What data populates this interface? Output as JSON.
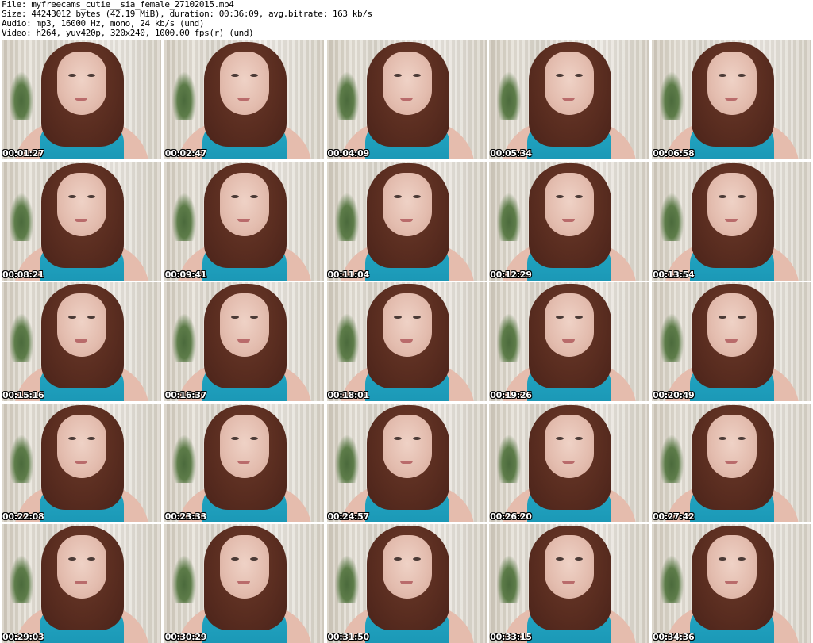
{
  "header": {
    "file": "File: myfreecams_cutie__sia_female_27102015.mp4",
    "size": "Size: 44243012 bytes (42.19 MiB), duration: 00:36:09, avg.bitrate: 163 kb/s",
    "audio": "Audio: mp3, 16000 Hz, mono, 24 kb/s (und)",
    "video": "Video: h264, yuv420p, 320x240, 1000.00 fps(r) (und)"
  },
  "thumbnails": [
    {
      "time": "00:01:27"
    },
    {
      "time": "00:02:47"
    },
    {
      "time": "00:04:09"
    },
    {
      "time": "00:05:34"
    },
    {
      "time": "00:06:58"
    },
    {
      "time": "00:08:21"
    },
    {
      "time": "00:09:41"
    },
    {
      "time": "00:11:04"
    },
    {
      "time": "00:12:29"
    },
    {
      "time": "00:13:54"
    },
    {
      "time": "00:15:16"
    },
    {
      "time": "00:16:37"
    },
    {
      "time": "00:18:01"
    },
    {
      "time": "00:19:26"
    },
    {
      "time": "00:20:49"
    },
    {
      "time": "00:22:08"
    },
    {
      "time": "00:23:33"
    },
    {
      "time": "00:24:57"
    },
    {
      "time": "00:26:20"
    },
    {
      "time": "00:27:42"
    },
    {
      "time": "00:29:03"
    },
    {
      "time": "00:30:29"
    },
    {
      "time": "00:31:50"
    },
    {
      "time": "00:33:15"
    },
    {
      "time": "00:34:36"
    }
  ]
}
